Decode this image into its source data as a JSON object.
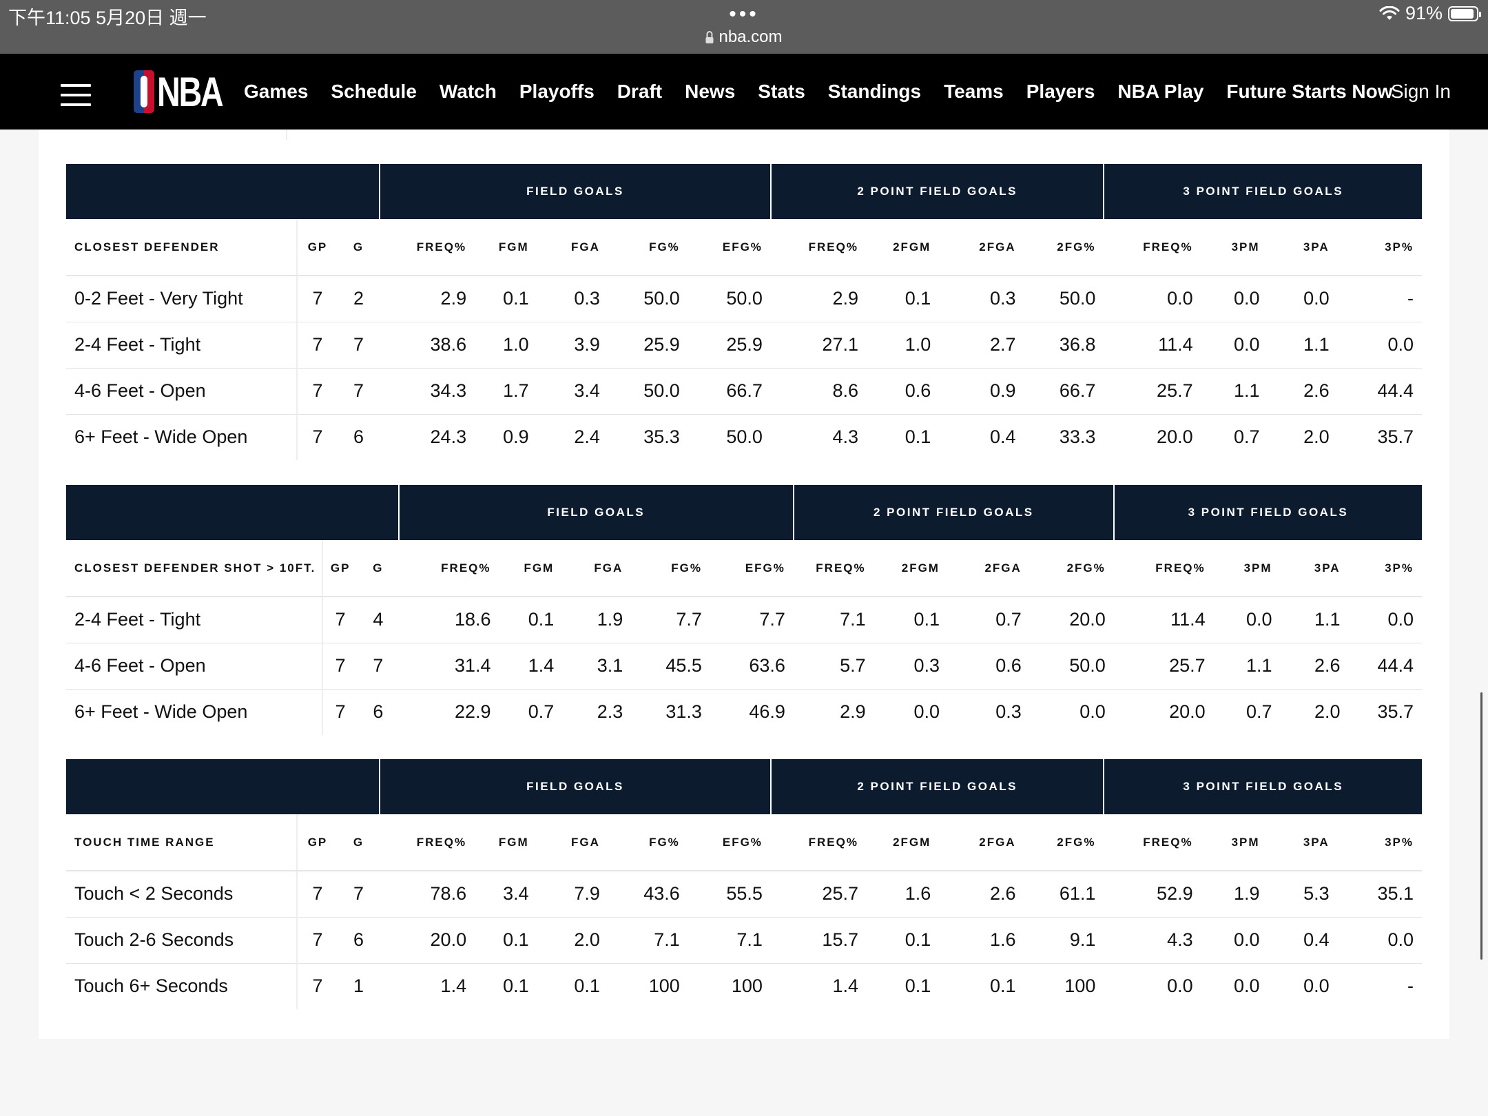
{
  "status_bar": {
    "time_date": "下午11:05   5月20日 週一",
    "dots": "•••",
    "url": "nba.com",
    "battery": "91%",
    "battery_level": 0.91
  },
  "nav": {
    "logo": "NBA",
    "links": [
      "Games",
      "Schedule",
      "Watch",
      "Playoffs",
      "Draft",
      "News",
      "Stats",
      "Standings",
      "Teams",
      "Players",
      "NBA Play",
      "Future Starts Now"
    ],
    "sign_in": "Sign In"
  },
  "tables": [
    {
      "groups": [
        "",
        "FIELD GOALS",
        "2 POINT FIELD GOALS",
        "3 POINT FIELD GOALS"
      ],
      "columns": [
        "CLOSEST DEFENDER",
        "GP",
        "G",
        "FREQ%",
        "FGM",
        "FGA",
        "FG%",
        "EFG%",
        "FREQ%",
        "2FGM",
        "2FGA",
        "2FG%",
        "FREQ%",
        "3PM",
        "3PA",
        "3P%"
      ],
      "rows": [
        [
          "0-2 Feet - Very Tight",
          "7",
          "2",
          "2.9",
          "0.1",
          "0.3",
          "50.0",
          "50.0",
          "2.9",
          "0.1",
          "0.3",
          "50.0",
          "0.0",
          "0.0",
          "0.0",
          "-"
        ],
        [
          "2-4 Feet - Tight",
          "7",
          "7",
          "38.6",
          "1.0",
          "3.9",
          "25.9",
          "25.9",
          "27.1",
          "1.0",
          "2.7",
          "36.8",
          "11.4",
          "0.0",
          "1.1",
          "0.0"
        ],
        [
          "4-6 Feet - Open",
          "7",
          "7",
          "34.3",
          "1.7",
          "3.4",
          "50.0",
          "66.7",
          "8.6",
          "0.6",
          "0.9",
          "66.7",
          "25.7",
          "1.1",
          "2.6",
          "44.4"
        ],
        [
          "6+ Feet - Wide Open",
          "7",
          "6",
          "24.3",
          "0.9",
          "2.4",
          "35.3",
          "50.0",
          "4.3",
          "0.1",
          "0.4",
          "33.3",
          "20.0",
          "0.7",
          "2.0",
          "35.7"
        ]
      ]
    },
    {
      "groups": [
        "",
        "FIELD GOALS",
        "2 POINT FIELD GOALS",
        "3 POINT FIELD GOALS"
      ],
      "columns": [
        "CLOSEST DEFENDER SHOT > 10FT.",
        "GP",
        "G",
        "FREQ%",
        "FGM",
        "FGA",
        "FG%",
        "EFG%",
        "FREQ%",
        "2FGM",
        "2FGA",
        "2FG%",
        "FREQ%",
        "3PM",
        "3PA",
        "3P%"
      ],
      "rows": [
        [
          "2-4 Feet - Tight",
          "7",
          "4",
          "18.6",
          "0.1",
          "1.9",
          "7.7",
          "7.7",
          "7.1",
          "0.1",
          "0.7",
          "20.0",
          "11.4",
          "0.0",
          "1.1",
          "0.0"
        ],
        [
          "4-6 Feet - Open",
          "7",
          "7",
          "31.4",
          "1.4",
          "3.1",
          "45.5",
          "63.6",
          "5.7",
          "0.3",
          "0.6",
          "50.0",
          "25.7",
          "1.1",
          "2.6",
          "44.4"
        ],
        [
          "6+ Feet - Wide Open",
          "7",
          "6",
          "22.9",
          "0.7",
          "2.3",
          "31.3",
          "46.9",
          "2.9",
          "0.0",
          "0.3",
          "0.0",
          "20.0",
          "0.7",
          "2.0",
          "35.7"
        ]
      ]
    },
    {
      "groups": [
        "",
        "FIELD GOALS",
        "2 POINT FIELD GOALS",
        "3 POINT FIELD GOALS"
      ],
      "columns": [
        "TOUCH TIME RANGE",
        "GP",
        "G",
        "FREQ%",
        "FGM",
        "FGA",
        "FG%",
        "EFG%",
        "FREQ%",
        "2FGM",
        "2FGA",
        "2FG%",
        "FREQ%",
        "3PM",
        "3PA",
        "3P%"
      ],
      "rows": [
        [
          "Touch < 2 Seconds",
          "7",
          "7",
          "78.6",
          "3.4",
          "7.9",
          "43.6",
          "55.5",
          "25.7",
          "1.6",
          "2.6",
          "61.1",
          "52.9",
          "1.9",
          "5.3",
          "35.1"
        ],
        [
          "Touch 2-6 Seconds",
          "7",
          "6",
          "20.0",
          "0.1",
          "2.0",
          "7.1",
          "7.1",
          "15.7",
          "0.1",
          "1.6",
          "9.1",
          "4.3",
          "0.0",
          "0.4",
          "0.0"
        ],
        [
          "Touch 6+ Seconds",
          "7",
          "1",
          "1.4",
          "0.1",
          "0.1",
          "100",
          "100",
          "1.4",
          "0.1",
          "0.1",
          "100",
          "0.0",
          "0.0",
          "0.0",
          "-"
        ]
      ]
    }
  ]
}
